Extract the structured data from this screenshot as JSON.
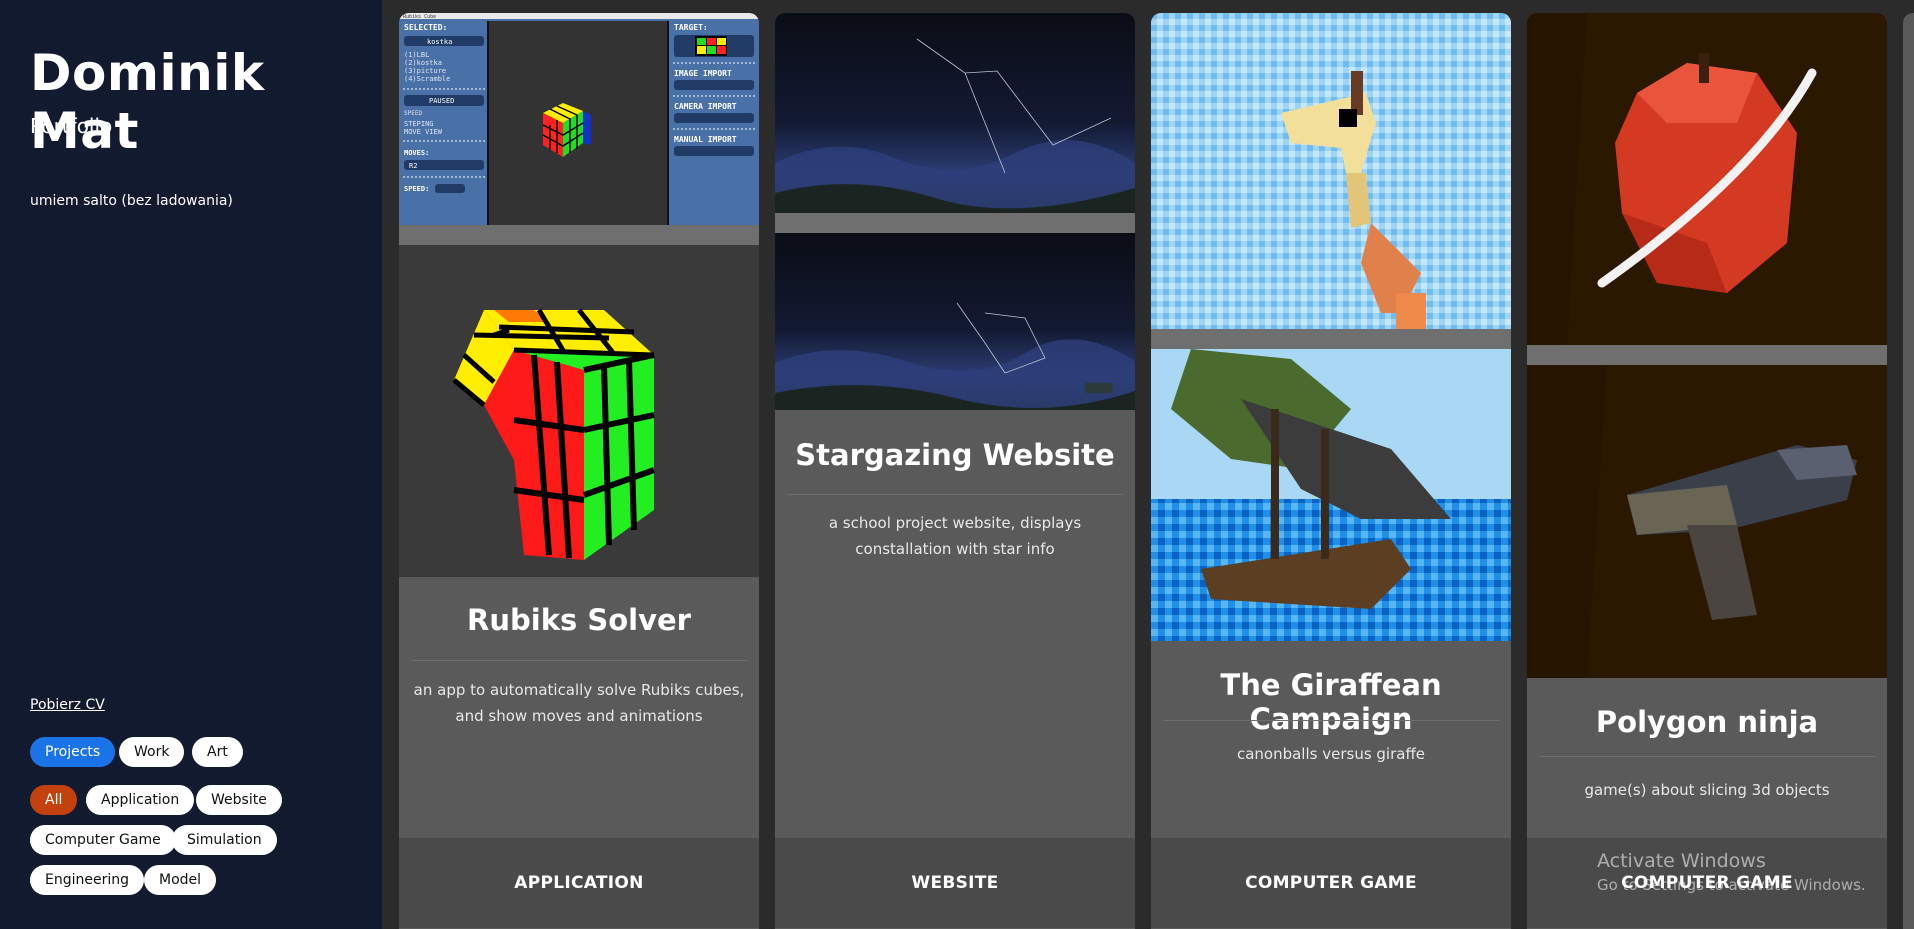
{
  "sidebar": {
    "name": "Dominik Mat",
    "subtitle": "Portfolio",
    "tagline": "umiem salto (bez ladowania)",
    "cv_link": "Pobierz CV",
    "sections": [
      "Projects",
      "Work",
      "Art"
    ],
    "filters": [
      "All",
      "Application",
      "Website",
      "Computer Game",
      "Simulation",
      "Engineering",
      "Model"
    ],
    "active_section": "Projects",
    "active_filter": "All"
  },
  "cards": [
    {
      "title": "Rubiks Solver",
      "description": "an app to automatically solve Rubiks cubes, and show moves and animations",
      "category": "APPLICATION",
      "app_ui": {
        "window_title": "Rubiks Cube",
        "selected_label": "SELECTED:",
        "selected_value": "kostka",
        "options": [
          "(1)LBL",
          "(2)kostka",
          "(3)picture",
          "(4)Scramble"
        ],
        "paused": "PAUSED",
        "speed_row": "SPEED",
        "stepping": "STEPING",
        "move_view": "MOVE VIEW",
        "moves_label": "MOVES:",
        "moves_value": "R2",
        "speed_label": "SPEED:",
        "target_label": "TARGET:",
        "image_import": "IMAGE IMPORT",
        "camera_import": "CAMERA IMPORT",
        "manual_import": "MANUAL IMPORT"
      }
    },
    {
      "title": "Stargazing Website",
      "description": "a school project website, displays constallation with star info",
      "category": "WEBSITE"
    },
    {
      "title": "The Giraffean Campaign",
      "description": "canonballs versus giraffe",
      "category": "COMPUTER GAME"
    },
    {
      "title": "Polygon ninja",
      "description": "game(s) about slicing 3d objects",
      "category": "COMPUTER GAME"
    }
  ],
  "watermark": {
    "line1": "Activate Windows",
    "line2": "Go to Settings to activate Windows."
  },
  "colors": {
    "sidebar_bg": "#111a2e",
    "page_bg": "#2b2b2b",
    "card_bg": "#5a5a5a",
    "accent_blue": "#1b73e8",
    "accent_orange": "#c2410c"
  }
}
